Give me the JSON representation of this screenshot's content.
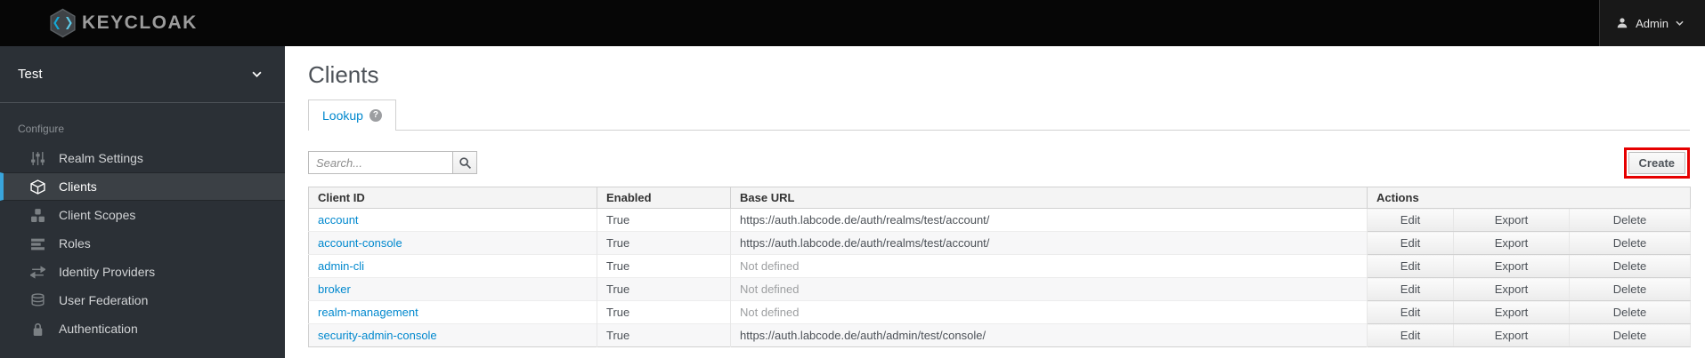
{
  "header": {
    "logo_text": "KEYCLOAK",
    "user_label": "Admin"
  },
  "sidebar": {
    "realm": "Test",
    "section_label": "Configure",
    "items": [
      {
        "label": "Realm Settings",
        "icon": "sliders-icon",
        "active": false
      },
      {
        "label": "Clients",
        "icon": "cube-icon",
        "active": true
      },
      {
        "label": "Client Scopes",
        "icon": "cubes-icon",
        "active": false
      },
      {
        "label": "Roles",
        "icon": "bars-icon",
        "active": false
      },
      {
        "label": "Identity Providers",
        "icon": "exchange-icon",
        "active": false
      },
      {
        "label": "User Federation",
        "icon": "database-icon",
        "active": false
      },
      {
        "label": "Authentication",
        "icon": "lock-icon",
        "active": false
      }
    ]
  },
  "main": {
    "title": "Clients",
    "tab": {
      "label": "Lookup",
      "help_glyph": "?"
    },
    "toolbar": {
      "search_placeholder": "Search...",
      "create_label": "Create"
    },
    "table": {
      "columns": [
        "Client ID",
        "Enabled",
        "Base URL",
        "Actions"
      ],
      "action_labels": [
        "Edit",
        "Export",
        "Delete"
      ],
      "rows": [
        {
          "client_id": "account",
          "enabled": "True",
          "base_url": "https://auth.labcode.de/auth/realms/test/account/",
          "url_type": "link"
        },
        {
          "client_id": "account-console",
          "enabled": "True",
          "base_url": "https://auth.labcode.de/auth/realms/test/account/",
          "url_type": "link"
        },
        {
          "client_id": "admin-cli",
          "enabled": "True",
          "base_url": "Not defined",
          "url_type": "muted"
        },
        {
          "client_id": "broker",
          "enabled": "True",
          "base_url": "Not defined",
          "url_type": "muted"
        },
        {
          "client_id": "realm-management",
          "enabled": "True",
          "base_url": "Not defined",
          "url_type": "muted"
        },
        {
          "client_id": "security-admin-console",
          "enabled": "True",
          "base_url": "https://auth.labcode.de/auth/admin/test/console/",
          "url_type": "link"
        }
      ]
    }
  },
  "colors": {
    "link_blue": "#0088ce",
    "sidebar_active_accent": "#39a5dc",
    "annotation_red": "#e60000",
    "header_bg": "#060606",
    "sidebar_bg": "#2b3036",
    "muted_text": "#9d9fa1"
  }
}
